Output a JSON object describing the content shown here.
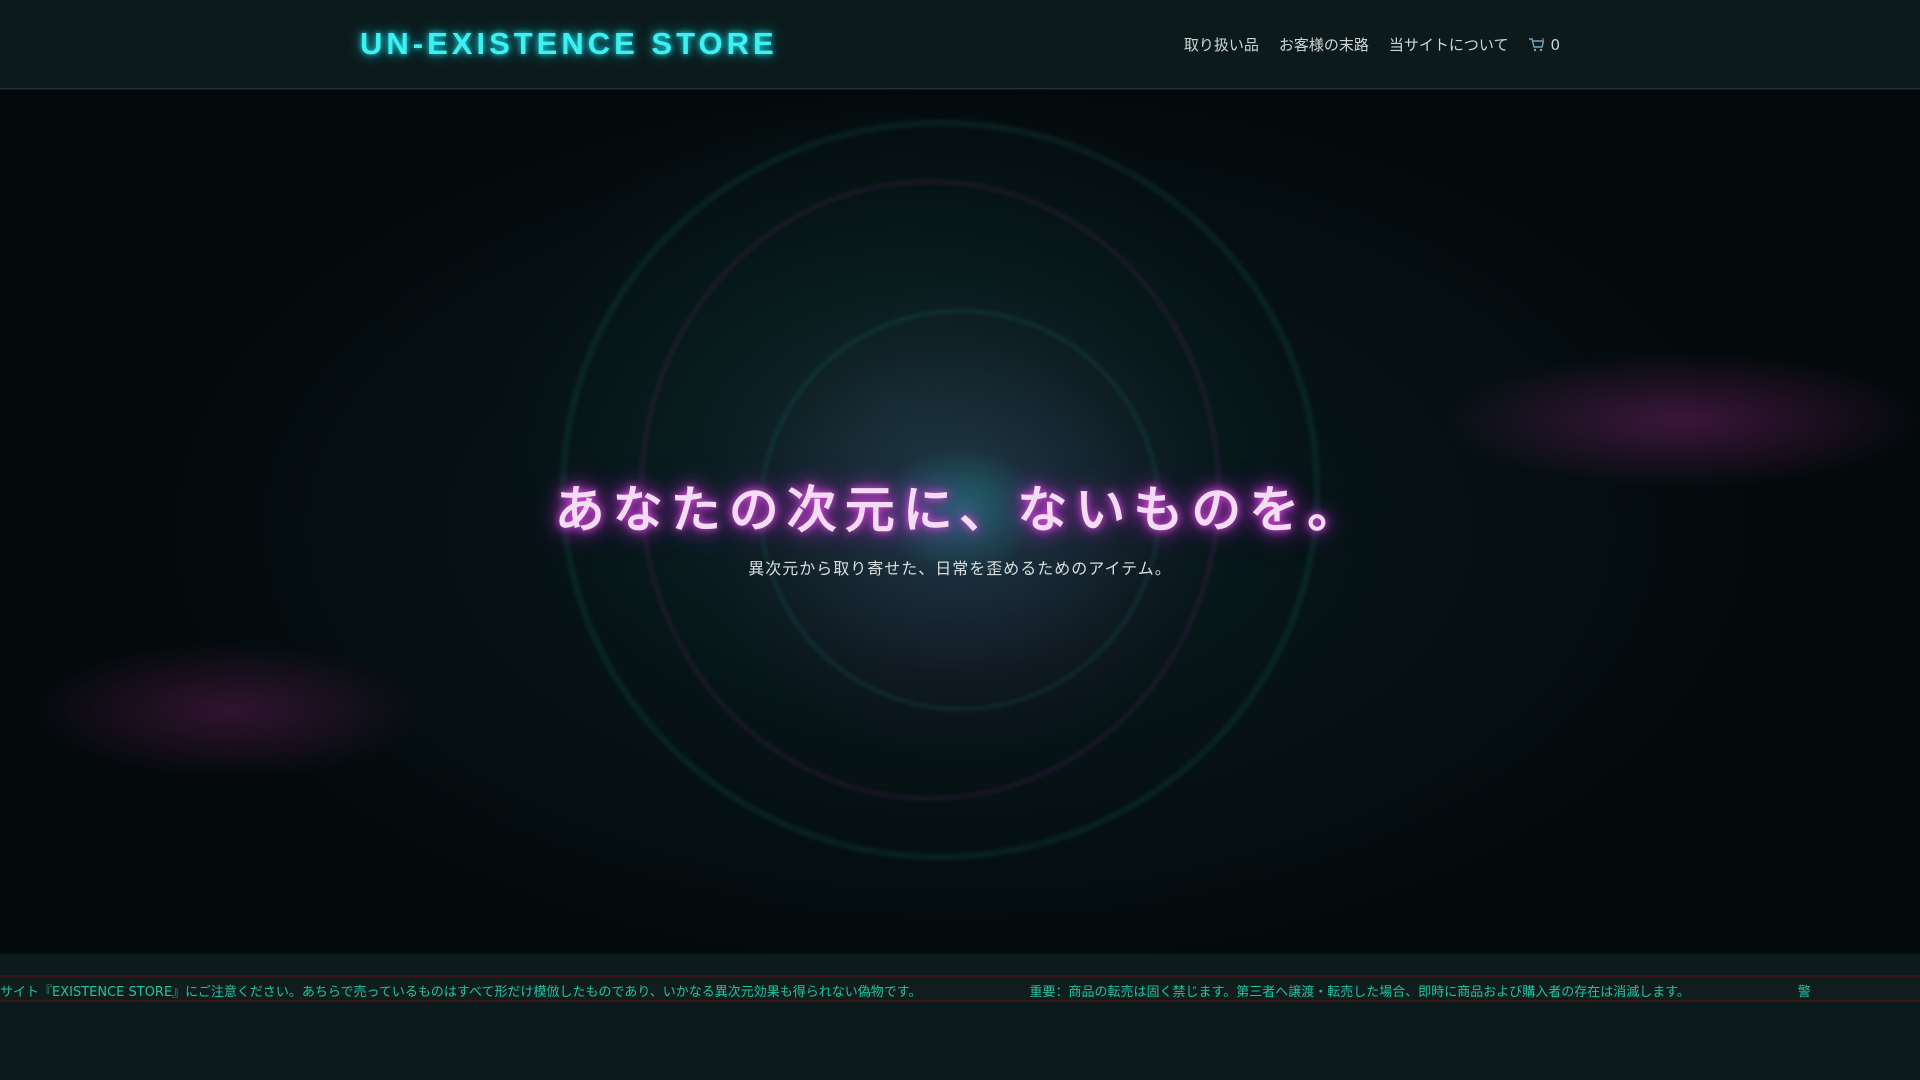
{
  "header": {
    "logo": "UN-EXISTENCE STORE",
    "nav": [
      "取り扱い品",
      "お客様の末路",
      "当サイトについて"
    ],
    "cart_count": "0"
  },
  "hero": {
    "headline": "あなたの次元に、ないものを。",
    "subtitle": "異次元から取り寄せた、日常を歪めるためのアイテム。"
  },
  "ticker": {
    "items": [
      "サイト『EXISTENCE STORE』にご注意ください。あちらで売っているものはすべて形だけ模倣したものであり、いかなる異次元効果も得られない偽物です。",
      "重要：商品の転売は固く禁じます。第三者へ譲渡・転売した場合、即時に商品および購入者の存在は消滅します。",
      "警"
    ]
  }
}
